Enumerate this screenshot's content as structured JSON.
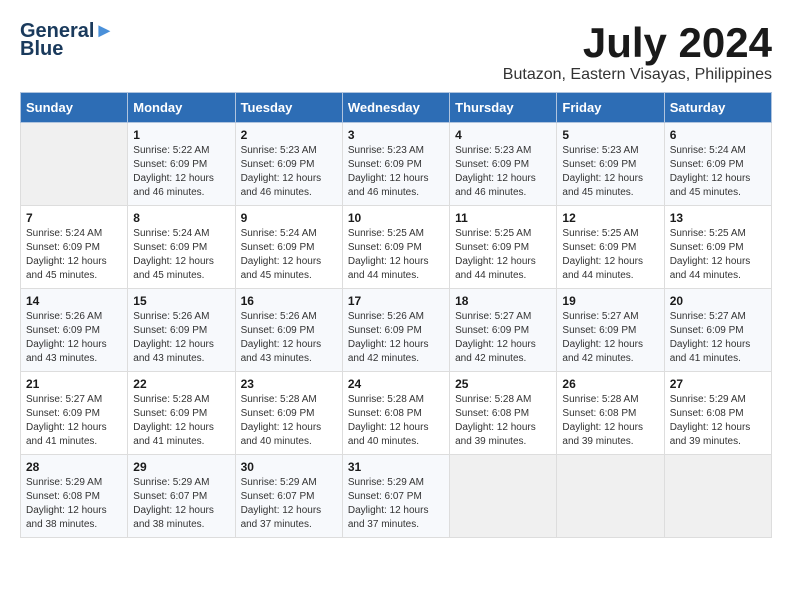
{
  "header": {
    "logo_line1": "General",
    "logo_line2": "Blue",
    "month": "July 2024",
    "location": "Butazon, Eastern Visayas, Philippines"
  },
  "days_of_week": [
    "Sunday",
    "Monday",
    "Tuesday",
    "Wednesday",
    "Thursday",
    "Friday",
    "Saturday"
  ],
  "weeks": [
    [
      {
        "day": "",
        "sunrise": "",
        "sunset": "",
        "daylight": ""
      },
      {
        "day": "1",
        "sunrise": "Sunrise: 5:22 AM",
        "sunset": "Sunset: 6:09 PM",
        "daylight": "Daylight: 12 hours and 46 minutes."
      },
      {
        "day": "2",
        "sunrise": "Sunrise: 5:23 AM",
        "sunset": "Sunset: 6:09 PM",
        "daylight": "Daylight: 12 hours and 46 minutes."
      },
      {
        "day": "3",
        "sunrise": "Sunrise: 5:23 AM",
        "sunset": "Sunset: 6:09 PM",
        "daylight": "Daylight: 12 hours and 46 minutes."
      },
      {
        "day": "4",
        "sunrise": "Sunrise: 5:23 AM",
        "sunset": "Sunset: 6:09 PM",
        "daylight": "Daylight: 12 hours and 46 minutes."
      },
      {
        "day": "5",
        "sunrise": "Sunrise: 5:23 AM",
        "sunset": "Sunset: 6:09 PM",
        "daylight": "Daylight: 12 hours and 45 minutes."
      },
      {
        "day": "6",
        "sunrise": "Sunrise: 5:24 AM",
        "sunset": "Sunset: 6:09 PM",
        "daylight": "Daylight: 12 hours and 45 minutes."
      }
    ],
    [
      {
        "day": "7",
        "sunrise": "Sunrise: 5:24 AM",
        "sunset": "Sunset: 6:09 PM",
        "daylight": "Daylight: 12 hours and 45 minutes."
      },
      {
        "day": "8",
        "sunrise": "Sunrise: 5:24 AM",
        "sunset": "Sunset: 6:09 PM",
        "daylight": "Daylight: 12 hours and 45 minutes."
      },
      {
        "day": "9",
        "sunrise": "Sunrise: 5:24 AM",
        "sunset": "Sunset: 6:09 PM",
        "daylight": "Daylight: 12 hours and 45 minutes."
      },
      {
        "day": "10",
        "sunrise": "Sunrise: 5:25 AM",
        "sunset": "Sunset: 6:09 PM",
        "daylight": "Daylight: 12 hours and 44 minutes."
      },
      {
        "day": "11",
        "sunrise": "Sunrise: 5:25 AM",
        "sunset": "Sunset: 6:09 PM",
        "daylight": "Daylight: 12 hours and 44 minutes."
      },
      {
        "day": "12",
        "sunrise": "Sunrise: 5:25 AM",
        "sunset": "Sunset: 6:09 PM",
        "daylight": "Daylight: 12 hours and 44 minutes."
      },
      {
        "day": "13",
        "sunrise": "Sunrise: 5:25 AM",
        "sunset": "Sunset: 6:09 PM",
        "daylight": "Daylight: 12 hours and 44 minutes."
      }
    ],
    [
      {
        "day": "14",
        "sunrise": "Sunrise: 5:26 AM",
        "sunset": "Sunset: 6:09 PM",
        "daylight": "Daylight: 12 hours and 43 minutes."
      },
      {
        "day": "15",
        "sunrise": "Sunrise: 5:26 AM",
        "sunset": "Sunset: 6:09 PM",
        "daylight": "Daylight: 12 hours and 43 minutes."
      },
      {
        "day": "16",
        "sunrise": "Sunrise: 5:26 AM",
        "sunset": "Sunset: 6:09 PM",
        "daylight": "Daylight: 12 hours and 43 minutes."
      },
      {
        "day": "17",
        "sunrise": "Sunrise: 5:26 AM",
        "sunset": "Sunset: 6:09 PM",
        "daylight": "Daylight: 12 hours and 42 minutes."
      },
      {
        "day": "18",
        "sunrise": "Sunrise: 5:27 AM",
        "sunset": "Sunset: 6:09 PM",
        "daylight": "Daylight: 12 hours and 42 minutes."
      },
      {
        "day": "19",
        "sunrise": "Sunrise: 5:27 AM",
        "sunset": "Sunset: 6:09 PM",
        "daylight": "Daylight: 12 hours and 42 minutes."
      },
      {
        "day": "20",
        "sunrise": "Sunrise: 5:27 AM",
        "sunset": "Sunset: 6:09 PM",
        "daylight": "Daylight: 12 hours and 41 minutes."
      }
    ],
    [
      {
        "day": "21",
        "sunrise": "Sunrise: 5:27 AM",
        "sunset": "Sunset: 6:09 PM",
        "daylight": "Daylight: 12 hours and 41 minutes."
      },
      {
        "day": "22",
        "sunrise": "Sunrise: 5:28 AM",
        "sunset": "Sunset: 6:09 PM",
        "daylight": "Daylight: 12 hours and 41 minutes."
      },
      {
        "day": "23",
        "sunrise": "Sunrise: 5:28 AM",
        "sunset": "Sunset: 6:09 PM",
        "daylight": "Daylight: 12 hours and 40 minutes."
      },
      {
        "day": "24",
        "sunrise": "Sunrise: 5:28 AM",
        "sunset": "Sunset: 6:08 PM",
        "daylight": "Daylight: 12 hours and 40 minutes."
      },
      {
        "day": "25",
        "sunrise": "Sunrise: 5:28 AM",
        "sunset": "Sunset: 6:08 PM",
        "daylight": "Daylight: 12 hours and 39 minutes."
      },
      {
        "day": "26",
        "sunrise": "Sunrise: 5:28 AM",
        "sunset": "Sunset: 6:08 PM",
        "daylight": "Daylight: 12 hours and 39 minutes."
      },
      {
        "day": "27",
        "sunrise": "Sunrise: 5:29 AM",
        "sunset": "Sunset: 6:08 PM",
        "daylight": "Daylight: 12 hours and 39 minutes."
      }
    ],
    [
      {
        "day": "28",
        "sunrise": "Sunrise: 5:29 AM",
        "sunset": "Sunset: 6:08 PM",
        "daylight": "Daylight: 12 hours and 38 minutes."
      },
      {
        "day": "29",
        "sunrise": "Sunrise: 5:29 AM",
        "sunset": "Sunset: 6:07 PM",
        "daylight": "Daylight: 12 hours and 38 minutes."
      },
      {
        "day": "30",
        "sunrise": "Sunrise: 5:29 AM",
        "sunset": "Sunset: 6:07 PM",
        "daylight": "Daylight: 12 hours and 37 minutes."
      },
      {
        "day": "31",
        "sunrise": "Sunrise: 5:29 AM",
        "sunset": "Sunset: 6:07 PM",
        "daylight": "Daylight: 12 hours and 37 minutes."
      },
      {
        "day": "",
        "sunrise": "",
        "sunset": "",
        "daylight": ""
      },
      {
        "day": "",
        "sunrise": "",
        "sunset": "",
        "daylight": ""
      },
      {
        "day": "",
        "sunrise": "",
        "sunset": "",
        "daylight": ""
      }
    ]
  ]
}
